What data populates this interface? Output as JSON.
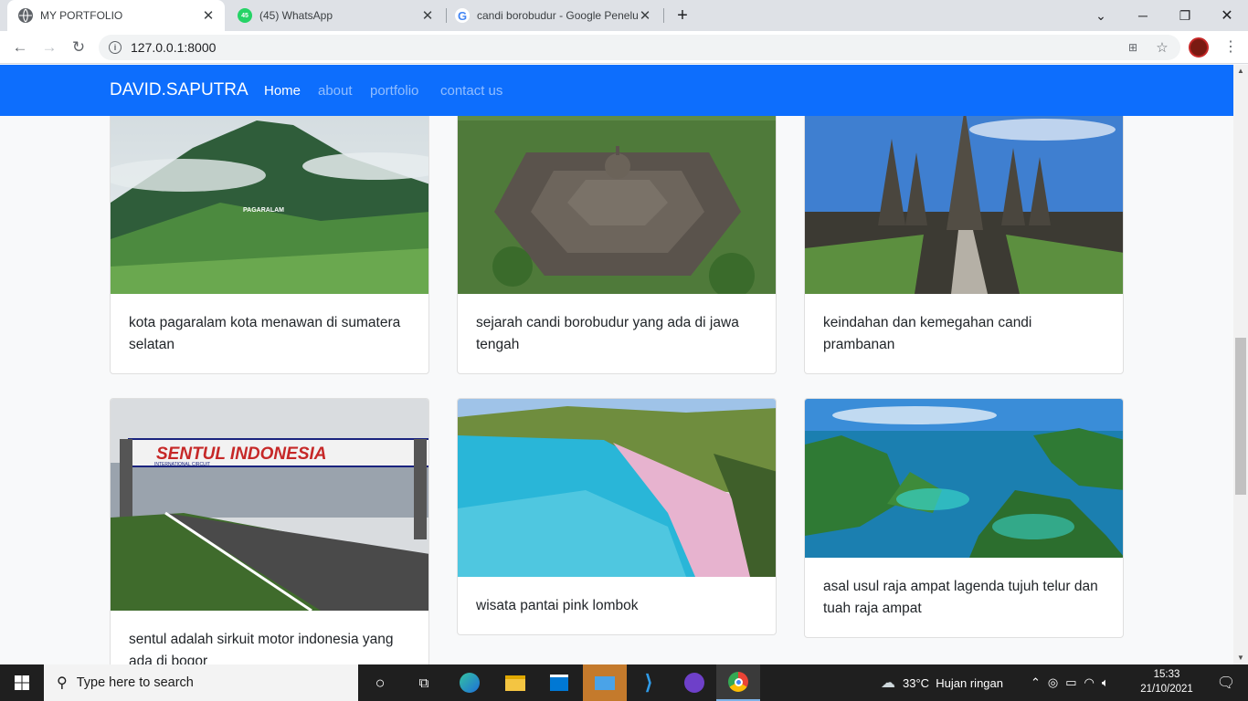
{
  "browser": {
    "tabs": [
      {
        "title": "MY PORTFOLIO",
        "favicon": "globe-icon",
        "active": true
      },
      {
        "title": "(45) WhatsApp",
        "favicon": "whatsapp-icon",
        "badge": "45",
        "active": false
      },
      {
        "title": "candi borobudur - Google Penelusuran",
        "favicon": "google-icon",
        "active": false
      }
    ],
    "new_tab_label": "+",
    "url": "127.0.0.1:8000"
  },
  "navbar": {
    "brand": "DAVID.SAPUTRA",
    "links": [
      {
        "label": "Home",
        "active": true
      },
      {
        "label": "about",
        "active": false
      },
      {
        "label": "portfolio",
        "active": false
      },
      {
        "label": "contact us",
        "active": false
      }
    ],
    "color": "#0d6efd"
  },
  "cards": [
    {
      "text": "kota pagaralam kota menawan di sumatera selatan",
      "image": "mountain-pagaralam-photo",
      "sign": "PAGARALAM"
    },
    {
      "text": "sejarah candi borobudur yang ada di jawa tengah",
      "image": "borobudur-temple-photo"
    },
    {
      "text": "keindahan dan kemegahan candi prambanan",
      "image": "prambanan-temple-photo"
    },
    {
      "text": "sentul adalah sirkuit motor indonesia yang ada di bogor",
      "image": "sentul-circuit-photo",
      "sign": "SENTUL INDONESIA",
      "sign_sub": "INTERNATIONAL CIRCUIT"
    },
    {
      "text": "wisata pantai pink lombok",
      "image": "pink-beach-photo"
    },
    {
      "text": "asal usul raja ampat lagenda tujuh telur dan tuah raja ampat",
      "image": "raja-ampat-photo"
    }
  ],
  "taskbar": {
    "search_placeholder": "Type here to search",
    "weather": "33°C  Hujan ringan",
    "time": "15:33",
    "date": "21/10/2021"
  }
}
